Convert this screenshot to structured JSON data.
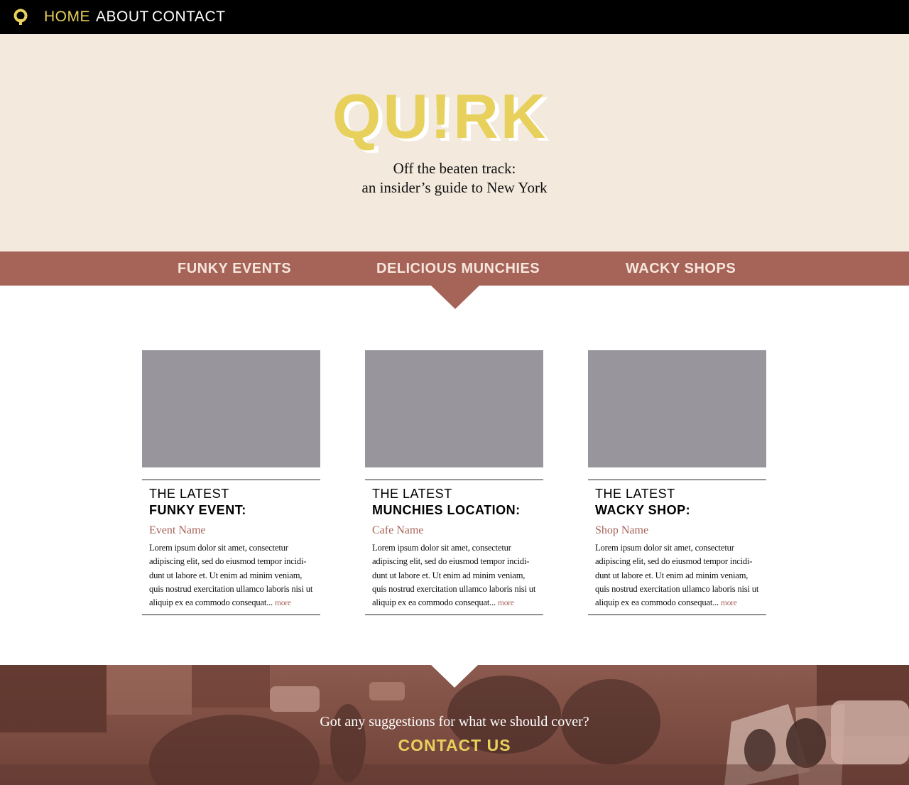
{
  "nav": {
    "items": [
      "HOME",
      "ABOUT",
      "CONTACT"
    ],
    "active": "HOME"
  },
  "hero": {
    "logo_text": "QU!RK",
    "tagline_line1": "Off the beaten track:",
    "tagline_line2": "an insider’s guide to New York"
  },
  "categories": {
    "items": [
      "FUNKY EVENTS",
      "DELICIOUS MUNCHIES",
      "WACKY SHOPS"
    ],
    "selected": "DELICIOUS MUNCHIES"
  },
  "cards": [
    {
      "kicker": "THE LATEST",
      "title": "FUNKY EVENT:",
      "name": "Event Name",
      "text": "Lorem ipsum dolor sit amet, consectetur adipiscing elit, sed do eiusmod tempor incidi- dunt ut labore et. Ut enim ad minim veniam, quis nostrud exercitation ullamco laboris nisi ut aliquip ex ea commodo consequat...",
      "more": "more"
    },
    {
      "kicker": "THE LATEST",
      "title": "MUNCHIES LOCATION:",
      "name": "Cafe Name",
      "text": "Lorem ipsum dolor sit amet, consectetur adipiscing elit, sed do eiusmod tempor incidi- dunt ut labore et. Ut enim ad minim veniam, quis nostrud exercitation ullamco laboris nisi ut aliquip ex ea commodo consequat...",
      "more": "more"
    },
    {
      "kicker": "THE LATEST",
      "title": "WACKY SHOP:",
      "name": "Shop Name",
      "text": "Lorem ipsum dolor sit amet, consectetur adipiscing elit, sed do eiusmod tempor incidi- dunt ut labore et. Ut enim ad minim veniam, quis nostrud exercitation ullamco laboris nisi ut aliquip ex ea commodo consequat...",
      "more": "more"
    }
  ],
  "footer": {
    "question": "Got any suggestions for what we should cover?",
    "cta": "CONTACT US"
  },
  "colors": {
    "accent_yellow": "#e8d05c",
    "accent_rust": "#a66358",
    "hero_bg": "#f3e9dd",
    "topbar_bg": "#000000",
    "image_placeholder": "#98969c"
  },
  "icons": {
    "logo": "quirk-q-logo-icon",
    "category_pointer": "triangle-down-icon",
    "footer_notch": "triangle-down-icon"
  }
}
